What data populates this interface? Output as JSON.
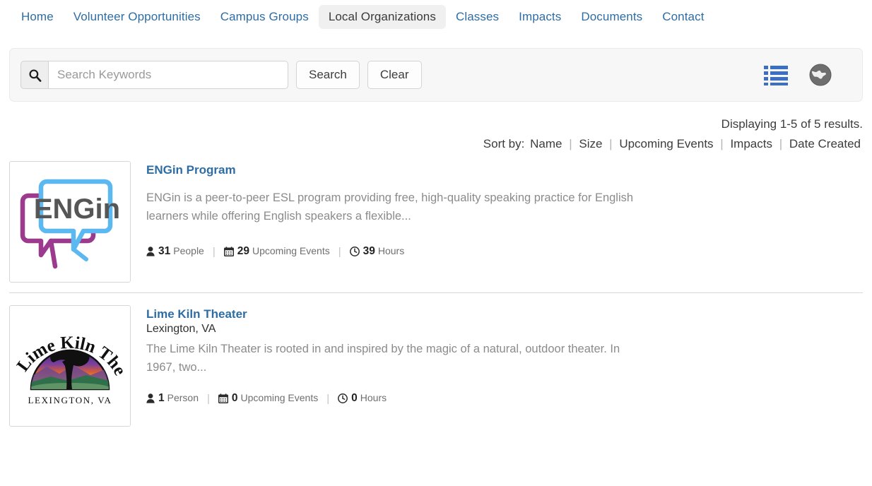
{
  "nav": {
    "items": [
      {
        "label": "Home",
        "active": false
      },
      {
        "label": "Volunteer Opportunities",
        "active": false
      },
      {
        "label": "Campus Groups",
        "active": false
      },
      {
        "label": "Local Organizations",
        "active": true
      },
      {
        "label": "Classes",
        "active": false
      },
      {
        "label": "Impacts",
        "active": false
      },
      {
        "label": "Documents",
        "active": false
      },
      {
        "label": "Contact",
        "active": false
      }
    ]
  },
  "search": {
    "icon": "search-icon",
    "placeholder": "Search Keywords",
    "value": "",
    "search_label": "Search",
    "clear_label": "Clear",
    "views": [
      {
        "icon": "list-view-icon",
        "active": true,
        "color": "#3a6fc4"
      },
      {
        "icon": "globe-map-view-icon",
        "active": false,
        "color": "#6e6e6e"
      }
    ]
  },
  "results_meta": {
    "displaying": "Displaying 1-5 of 5 results.",
    "sort_label": "Sort by:",
    "separator": "|",
    "sort_options": [
      "Name",
      "Size",
      "Upcoming Events",
      "Impacts",
      "Date Created"
    ]
  },
  "results": [
    {
      "logo": "engin-logo",
      "title": "ENGin Program",
      "subtitle": "",
      "description": "ENGin is a peer-to-peer ESL program providing free, high-quality speaking practice for English learners while offering English speakers a flexible...",
      "stats": [
        {
          "icon": "person-icon",
          "value": "31",
          "label": "People"
        },
        {
          "icon": "calendar-icon",
          "value": "29",
          "label": "Upcoming Events"
        },
        {
          "icon": "clock-icon",
          "value": "39",
          "label": "Hours"
        }
      ]
    },
    {
      "logo": "lime-kiln-logo",
      "title": "Lime Kiln Theater",
      "subtitle": "Lexington, VA",
      "description": "The Lime Kiln Theater is rooted in and inspired by the magic of a natural, outdoor theater. In 1967, two...",
      "stats": [
        {
          "icon": "person-icon",
          "value": "1",
          "label": "Person"
        },
        {
          "icon": "calendar-icon",
          "value": "0",
          "label": "Upcoming Events"
        },
        {
          "icon": "clock-icon",
          "value": "0",
          "label": "Hours"
        }
      ]
    }
  ],
  "colors": {
    "link_blue": "#2e6da4",
    "active_tab_bg": "#f0f0f0",
    "list_icon_blue": "#3a6fc4",
    "globe_gray": "#6e6e6e"
  }
}
